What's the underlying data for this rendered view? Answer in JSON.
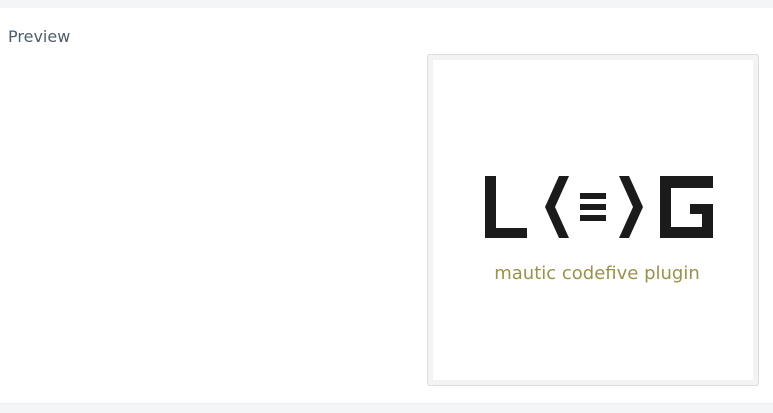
{
  "section": {
    "label": "Preview"
  },
  "preview": {
    "logo_text": "LEG",
    "subtitle": "mautic codefive plugin",
    "colors": {
      "logo_mark": "#1b1b1b",
      "subtitle": "#9a9248",
      "label": "#4e5d6c"
    }
  }
}
